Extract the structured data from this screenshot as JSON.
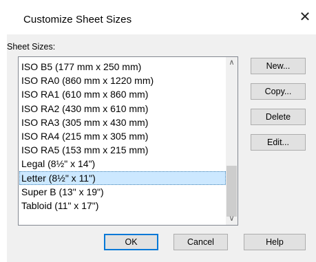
{
  "dialog": {
    "title": "Customize Sheet Sizes",
    "close_glyph": "✕"
  },
  "sheet_sizes": {
    "label": "Sheet Sizes:",
    "items": [
      {
        "label": "ISO B5  (177 mm x 250 mm)",
        "selected": false
      },
      {
        "label": "ISO RA0  (860 mm x 1220 mm)",
        "selected": false
      },
      {
        "label": "ISO RA1  (610 mm x 860 mm)",
        "selected": false
      },
      {
        "label": "ISO RA2  (430 mm x 610 mm)",
        "selected": false
      },
      {
        "label": "ISO RA3  (305 mm x 430 mm)",
        "selected": false
      },
      {
        "label": "ISO RA4  (215 mm x 305 mm)",
        "selected": false
      },
      {
        "label": "ISO RA5  (153 mm x 215 mm)",
        "selected": false
      },
      {
        "label": "Legal  (8½\" x 14\")",
        "selected": false
      },
      {
        "label": "Letter  (8½\" x 11\")",
        "selected": true
      },
      {
        "label": "Super B  (13\" x 19\")",
        "selected": false
      },
      {
        "label": "Tabloid  (11\" x 17\")",
        "selected": false
      }
    ],
    "scroll_up_glyph": "∧",
    "scroll_down_glyph": "∨"
  },
  "side_buttons": {
    "new_label": "New...",
    "copy_label": "Copy...",
    "delete_label": "Delete",
    "edit_label": "Edit..."
  },
  "footer_buttons": {
    "ok_label": "OK",
    "cancel_label": "Cancel",
    "help_label": "Help"
  },
  "colors": {
    "selection": "#cce8ff",
    "default_button_border": "#0078d7"
  }
}
